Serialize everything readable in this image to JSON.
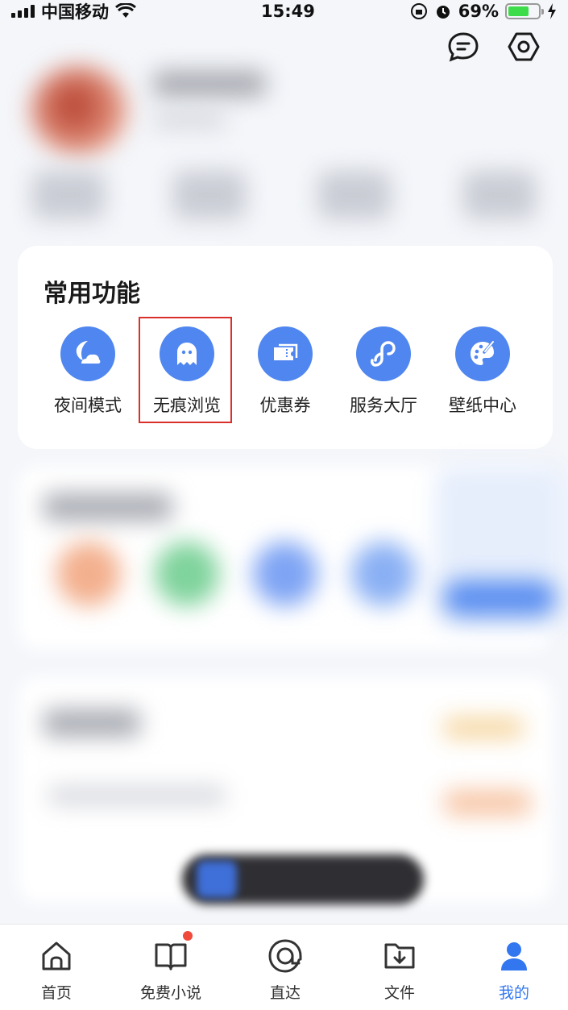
{
  "status_bar": {
    "carrier": "中国移动",
    "time": "15:49",
    "battery": "69%",
    "battery_level": 0.69
  },
  "header": {
    "message_icon": "message-icon",
    "settings_icon": "hexagon-settings-icon"
  },
  "common_functions": {
    "title": "常用功能",
    "items": [
      {
        "label": "夜间模式",
        "icon": "night-mode-icon"
      },
      {
        "label": "无痕浏览",
        "icon": "ghost-icon"
      },
      {
        "label": "优惠券",
        "icon": "coupon-icon"
      },
      {
        "label": "服务大厅",
        "icon": "mini-program-icon"
      },
      {
        "label": "壁纸中心",
        "icon": "palette-icon"
      }
    ]
  },
  "bottom_nav": {
    "items": [
      {
        "label": "首页",
        "icon": "home-icon"
      },
      {
        "label": "免费小说",
        "icon": "book-icon"
      },
      {
        "label": "直达",
        "icon": "at-direct-icon"
      },
      {
        "label": "文件",
        "icon": "file-download-icon"
      },
      {
        "label": "我的",
        "icon": "profile-icon"
      }
    ],
    "active_index": 4
  },
  "colors": {
    "accent": "#4f86ef",
    "highlight": "#d9302c",
    "active_nav": "#3377f0"
  }
}
